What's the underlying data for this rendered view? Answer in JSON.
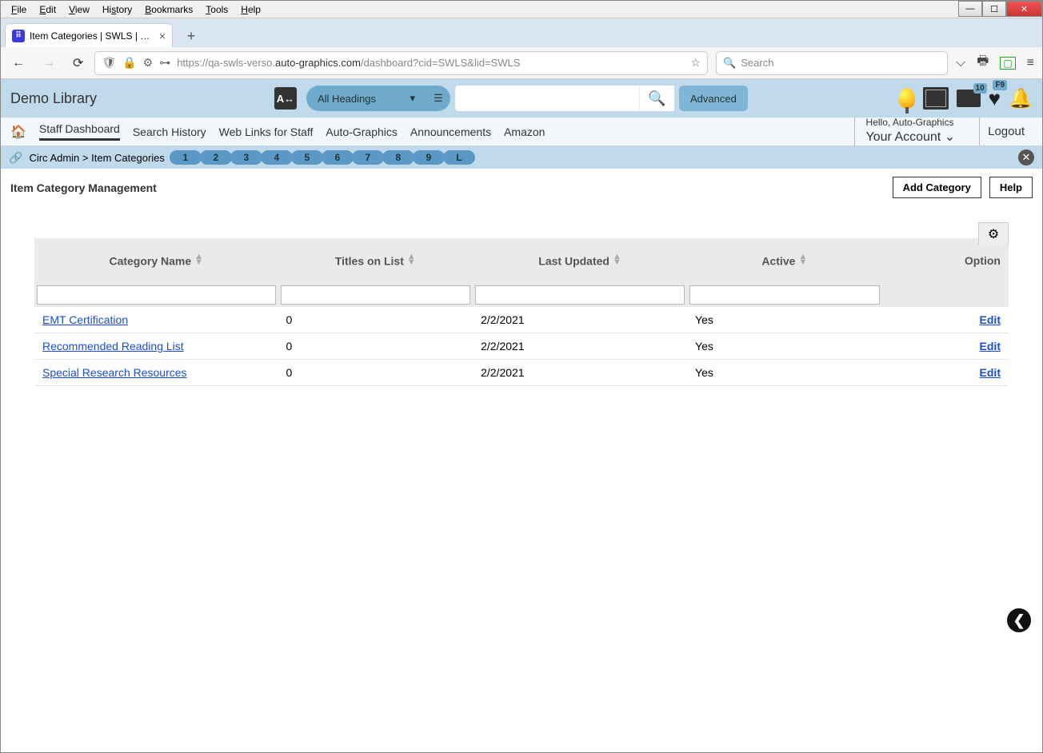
{
  "browser_menu": [
    "File",
    "Edit",
    "View",
    "History",
    "Bookmarks",
    "Tools",
    "Help"
  ],
  "tab": {
    "title": "Item Categories | SWLS | swls | A"
  },
  "url": {
    "prefix": "https://qa-swls-verso.",
    "host": "auto-graphics.com",
    "path": "/dashboard?cid=SWLS&lid=SWLS"
  },
  "search_placeholder": "Search",
  "lib_name": "Demo Library",
  "heading_dropdown": "All Headings",
  "advanced": "Advanced",
  "list_badge": "10",
  "heart_badge": "F9",
  "nav": {
    "items": [
      "Staff Dashboard",
      "Search History",
      "Web Links for Staff",
      "Auto-Graphics",
      "Announcements",
      "Amazon"
    ],
    "hello": "Hello, Auto-Graphics",
    "account": "Your Account",
    "logout": "Logout"
  },
  "crumb": {
    "parent": "Circ Admin",
    "current": "Item Categories"
  },
  "pills": [
    "1",
    "2",
    "3",
    "4",
    "5",
    "6",
    "7",
    "8",
    "9",
    "L"
  ],
  "page_title": "Item Category Management",
  "add_btn": "Add Category",
  "help_btn": "Help",
  "columns": [
    "Category Name",
    "Titles on List",
    "Last Updated",
    "Active",
    "Option"
  ],
  "rows": [
    {
      "name": "EMT Certification",
      "titles": "0",
      "updated": "2/2/2021",
      "active": "Yes",
      "option": "Edit"
    },
    {
      "name": "Recommended Reading List",
      "titles": "0",
      "updated": "2/2/2021",
      "active": "Yes",
      "option": "Edit"
    },
    {
      "name": "Special Research Resources",
      "titles": "0",
      "updated": "2/2/2021",
      "active": "Yes",
      "option": "Edit"
    }
  ]
}
